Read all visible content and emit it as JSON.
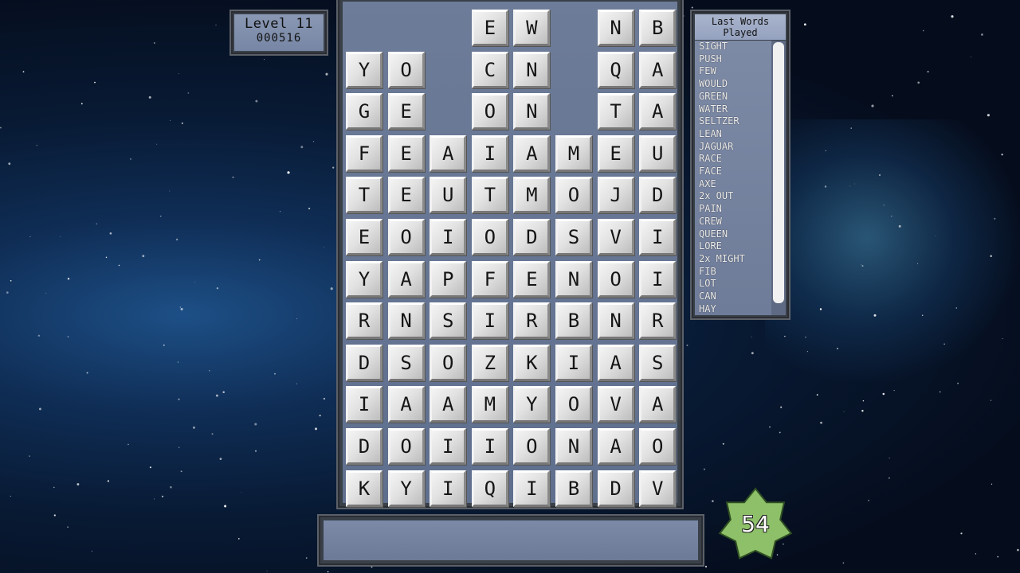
{
  "level": {
    "title": "Level 11",
    "score": "000516"
  },
  "board": {
    "rows": [
      [
        "",
        "",
        "",
        "E",
        "W",
        "",
        "N",
        "B"
      ],
      [
        "Y",
        "O",
        "",
        "C",
        "N",
        "",
        "Q",
        "A"
      ],
      [
        "G",
        "E",
        "",
        "O",
        "N",
        "",
        "T",
        "A"
      ],
      [
        "F",
        "E",
        "A",
        "I",
        "A",
        "M",
        "E",
        "U"
      ],
      [
        "T",
        "E",
        "U",
        "T",
        "M",
        "O",
        "J",
        "D"
      ],
      [
        "E",
        "O",
        "I",
        "O",
        "D",
        "S",
        "V",
        "I"
      ],
      [
        "Y",
        "A",
        "P",
        "F",
        "E",
        "N",
        "O",
        "I"
      ],
      [
        "R",
        "N",
        "S",
        "I",
        "R",
        "B",
        "N",
        "R"
      ],
      [
        "D",
        "S",
        "O",
        "Z",
        "K",
        "I",
        "A",
        "S"
      ],
      [
        "I",
        "A",
        "A",
        "M",
        "Y",
        "O",
        "V",
        "A"
      ],
      [
        "D",
        "O",
        "I",
        "I",
        "O",
        "N",
        "A",
        "O"
      ],
      [
        "K",
        "Y",
        "I",
        "Q",
        "I",
        "B",
        "D",
        "V"
      ]
    ]
  },
  "words_panel": {
    "title": "Last Words Played",
    "words": [
      "SIGHT",
      "PUSH",
      "FEW",
      "WOULD",
      "GREEN",
      "WATER",
      "SELTZER",
      "LEAN",
      "JAGUAR",
      "RACE",
      "FACE",
      "AXE",
      "2x OUT",
      "PAIN",
      "CREW",
      "QUEEN",
      "LORE",
      "2x MIGHT",
      "FIB",
      "LOT",
      "CAN",
      "HAY"
    ]
  },
  "input": {
    "current_word": ""
  },
  "star_counter": {
    "value": "54",
    "color": "#8ec06a"
  },
  "colors": {
    "panel": "#7686a4",
    "tile": "#e2e2e2",
    "frame": "#3a4048"
  }
}
